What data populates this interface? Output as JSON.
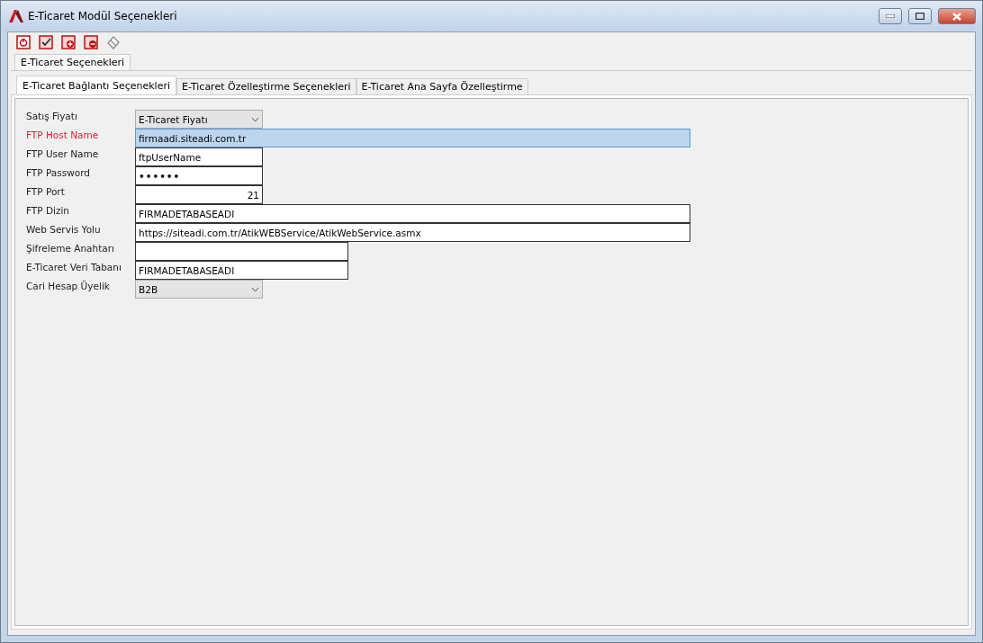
{
  "window": {
    "title": "E-Ticaret Modül Seçenekleri"
  },
  "outer_tabs": [
    {
      "label": "E-Ticaret Seçenekleri",
      "selected": true
    }
  ],
  "tabs": [
    {
      "label": "E-Ticaret Bağlantı Seçenekleri",
      "selected": true
    },
    {
      "label": "E-Ticaret Özelleştirme Seçenekleri",
      "selected": false
    },
    {
      "label": "E-Ticaret Ana Sayfa Özelleştirme",
      "selected": false
    }
  ],
  "fields": [
    {
      "label": "Satış Fiyatı",
      "kind": "combo",
      "value": "E-Ticaret Fiyatı",
      "required": false,
      "focused": false
    },
    {
      "label": "FTP Host Name",
      "kind": "text",
      "value": "firmaadi.siteadi.com.tr",
      "required": true,
      "focused": true
    },
    {
      "label": "FTP User Name",
      "kind": "text",
      "value": "ftpUserName",
      "required": false,
      "focused": false
    },
    {
      "label": "FTP Password",
      "kind": "password",
      "value": "••••••",
      "required": false,
      "focused": false
    },
    {
      "label": "FTP Port",
      "kind": "number",
      "value": "21",
      "required": false,
      "focused": false
    },
    {
      "label": "FTP Dizin",
      "kind": "text",
      "value": "FIRMADETABASEADI",
      "required": false,
      "focused": false
    },
    {
      "label": "Web Servis Yolu",
      "kind": "text",
      "value": "https://siteadi.com.tr/AtikWEBService/AtikWebService.asmx",
      "required": false,
      "focused": false
    },
    {
      "label": "Şifreleme Anahtarı",
      "kind": "text",
      "required": false,
      "focused": false
    },
    {
      "label": "E-Ticaret Veri Tabanı",
      "kind": "text",
      "value": "FIRMADETABASEADI",
      "required": false,
      "focused": false
    },
    {
      "label": "Cari Hesap Üyelik",
      "kind": "combo",
      "value": "B2B",
      "required": false,
      "focused": false
    }
  ]
}
